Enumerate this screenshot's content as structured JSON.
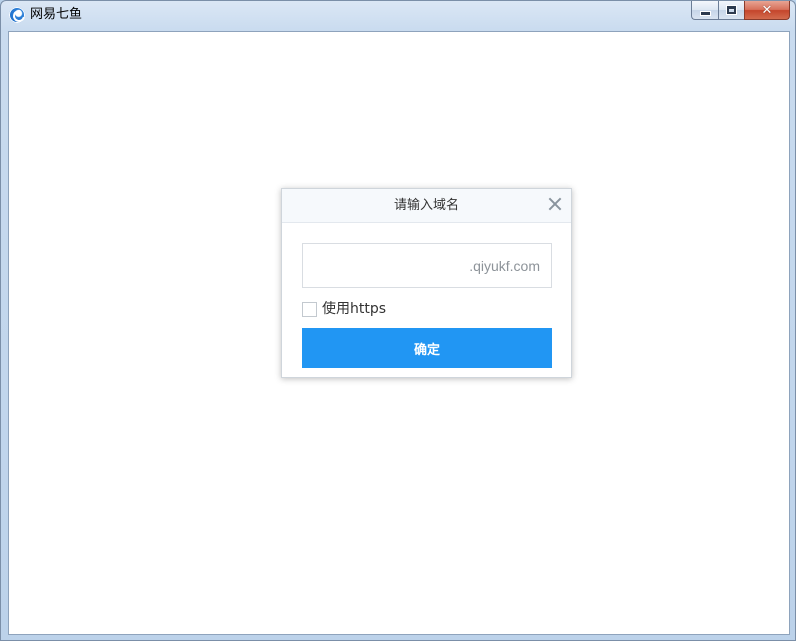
{
  "window": {
    "title": "网易七鱼",
    "icon": "qiyu-logo-icon",
    "controls": {
      "minimize_icon": "minimize-icon",
      "maximize_icon": "maximize-icon",
      "close_icon": "close-icon",
      "close_glyph": "✕"
    }
  },
  "dialog": {
    "title": "请输入域名",
    "close_icon": "close-icon",
    "domain_input": {
      "value": "",
      "suffix": ".qiyukf.com"
    },
    "https_checkbox": {
      "label": "使用https",
      "checked": false
    },
    "confirm_label": "确定"
  },
  "colors": {
    "accent": "#2196f3",
    "titlebar_close": "#c4452b"
  }
}
